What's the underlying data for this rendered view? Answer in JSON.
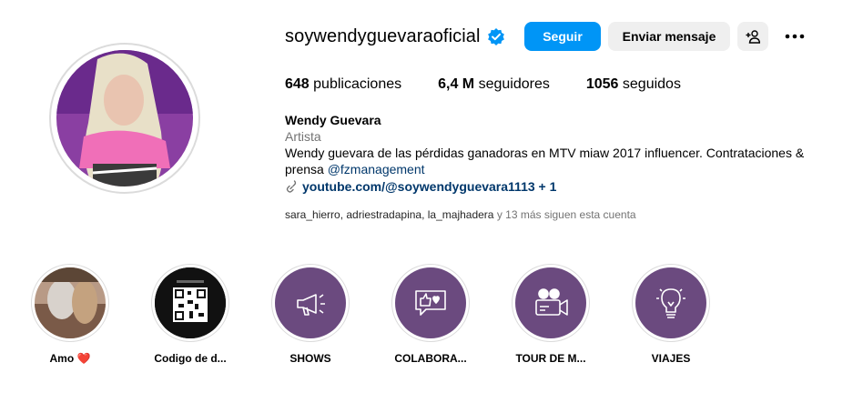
{
  "profile": {
    "username": "soywendyguevaraoficial",
    "verified": true,
    "follow_label": "Seguir",
    "message_label": "Enviar mensaje",
    "stats": {
      "posts_count": "648",
      "posts_label": "publicaciones",
      "followers_count": "6,4 M",
      "followers_label": "seguidores",
      "following_count": "1056",
      "following_label": "seguidos"
    },
    "bio": {
      "name": "Wendy Guevara",
      "category": "Artista",
      "text": "Wendy guevara de las pérdidas ganadoras en MTV miaw 2017 influencer. Contrataciones & prensa",
      "mention": "@fzmanagement",
      "link": "youtube.com/@soywendyguevara1113 + 1"
    },
    "followed_by": {
      "names": "sara_hierro, adriestradapina, la_majhadera",
      "rest": " y 13 más siguen esta cuenta"
    }
  },
  "highlights": [
    {
      "label": "Amo ❤️",
      "icon": "photo"
    },
    {
      "label": "Codigo de d...",
      "icon": "qr-code"
    },
    {
      "label": "SHOWS",
      "icon": "megaphone-icon"
    },
    {
      "label": "COLABORA...",
      "icon": "like-chat-icon"
    },
    {
      "label": "TOUR DE M...",
      "icon": "video-camera-icon"
    },
    {
      "label": "VIAJES",
      "icon": "lightbulb-icon"
    }
  ],
  "colors": {
    "accent": "#0095f6",
    "highlight_bg": "#6b4a7f",
    "secondary_button": "#efefef"
  }
}
